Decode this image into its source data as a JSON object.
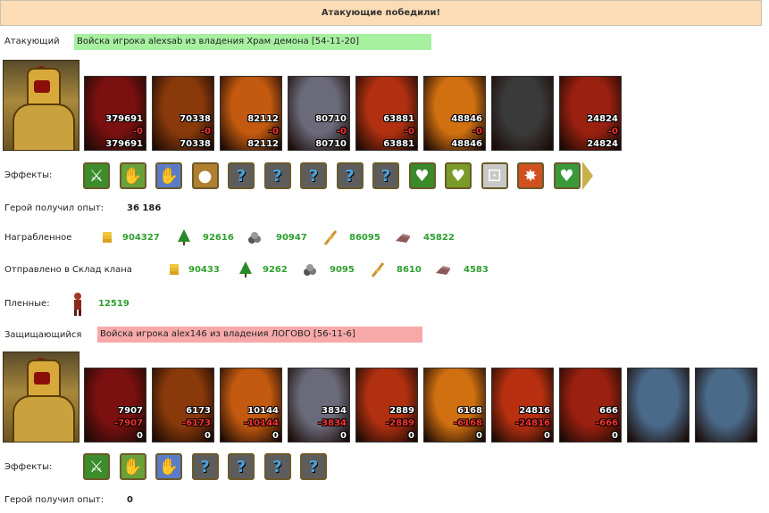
{
  "banner": "Атакующие победили!",
  "attacker": {
    "label": "Атакующий",
    "name": "Войска игрока alexsab из владения Храм демона [54-11-20]",
    "box_color": "#a6f0a0",
    "units": [
      {
        "icon": "red-dragon",
        "top": "379691",
        "mid": "-0",
        "bottom": "379691",
        "bg": "#7a1010"
      },
      {
        "icon": "skeleton-warrior",
        "top": "70338",
        "mid": "-0",
        "bottom": "70338",
        "bg": "#8a3a0a"
      },
      {
        "icon": "fire-beast",
        "top": "82112",
        "mid": "-0",
        "bottom": "82112",
        "bg": "#c35a10"
      },
      {
        "icon": "gargoyle",
        "top": "80710",
        "mid": "-0",
        "bottom": "80710",
        "bg": "#6a6a7a"
      },
      {
        "icon": "fire-elemental",
        "top": "63881",
        "mid": "-0",
        "bottom": "63881",
        "bg": "#b03010"
      },
      {
        "icon": "demon-warrior",
        "top": "48846",
        "mid": "-0",
        "bottom": "48846",
        "bg": "#d07010"
      },
      {
        "icon": "stone-golem",
        "top": "",
        "mid": "",
        "bottom": "",
        "bg": "#3a3a3a"
      },
      {
        "icon": "fire-mage",
        "top": "24824",
        "mid": "-0",
        "bottom": "24824",
        "bg": "#9a2010"
      }
    ],
    "effects_label": "Эффекты:",
    "effects": [
      {
        "icon": "sword-icon",
        "kind": "img",
        "bg": "#3c8c2c",
        "glyph": "⚔"
      },
      {
        "icon": "handshake-sword-icon",
        "kind": "img",
        "bg": "#6aa03a",
        "glyph": "✋"
      },
      {
        "icon": "hand-magic-icon",
        "kind": "img",
        "bg": "#5a7cc8",
        "glyph": "✋"
      },
      {
        "icon": "coins-icon",
        "kind": "img",
        "bg": "#b08030",
        "glyph": "●"
      },
      {
        "icon": "unknown-icon",
        "kind": "q",
        "glyph": "?"
      },
      {
        "icon": "unknown-icon",
        "kind": "q",
        "glyph": "?"
      },
      {
        "icon": "unknown-icon",
        "kind": "q",
        "glyph": "?"
      },
      {
        "icon": "unknown-icon",
        "kind": "q",
        "glyph": "?"
      },
      {
        "icon": "unknown-icon",
        "kind": "q",
        "glyph": "?"
      },
      {
        "icon": "apple-heart-icon",
        "kind": "img",
        "bg": "#3a8a2a",
        "glyph": "♥"
      },
      {
        "icon": "potion-heart-icon",
        "kind": "img",
        "bg": "#7a9a2a",
        "glyph": "♥"
      },
      {
        "icon": "dice-icon",
        "kind": "img",
        "bg": "#c8c8c8",
        "glyph": "⚀"
      },
      {
        "icon": "xp-burst-icon",
        "kind": "img",
        "bg": "#d05020",
        "glyph": "✸"
      },
      {
        "icon": "potion-green-icon",
        "kind": "img",
        "bg": "#3a9a3a",
        "glyph": "♥"
      }
    ],
    "xp_label": "Герой получил опыт:",
    "xp_value": "36 186"
  },
  "loot": {
    "label": "Награбленное",
    "items": [
      {
        "icon": "gold-icon",
        "value": "904327"
      },
      {
        "icon": "tree-icon",
        "value": "92616"
      },
      {
        "icon": "ore-icon",
        "value": "90947"
      },
      {
        "icon": "wheat-icon",
        "value": "86095"
      },
      {
        "icon": "stone-icon",
        "value": "45822"
      }
    ]
  },
  "clan": {
    "label": "Отправлено в Склад клана",
    "items": [
      {
        "icon": "gold-icon",
        "value": "90433"
      },
      {
        "icon": "tree-icon",
        "value": "9262"
      },
      {
        "icon": "ore-icon",
        "value": "9095"
      },
      {
        "icon": "wheat-icon",
        "value": "8610"
      },
      {
        "icon": "stone-icon",
        "value": "4583"
      }
    ]
  },
  "prisoners": {
    "label": "Пленные:",
    "value": "12519"
  },
  "defender": {
    "label": "Защищающийся",
    "name": "Войска игрока alex146 из владения ЛОГОВО [56-11-6]",
    "box_color": "#f7a9a9",
    "units": [
      {
        "icon": "red-dragon",
        "top": "7907",
        "mid": "-7907",
        "bottom": "0",
        "bg": "#7a1010"
      },
      {
        "icon": "skeleton-warrior",
        "top": "6173",
        "mid": "-6173",
        "bottom": "0",
        "bg": "#8a3a0a"
      },
      {
        "icon": "fire-beast",
        "top": "10144",
        "mid": "-10144",
        "bottom": "0",
        "bg": "#c35a10"
      },
      {
        "icon": "gargoyle",
        "top": "3834",
        "mid": "-3834",
        "bottom": "0",
        "bg": "#6a6a7a"
      },
      {
        "icon": "fire-elemental",
        "top": "2889",
        "mid": "-2889",
        "bottom": "0",
        "bg": "#b03010"
      },
      {
        "icon": "demon-warrior",
        "top": "6168",
        "mid": "-6168",
        "bottom": "0",
        "bg": "#d07010"
      },
      {
        "icon": "demon-lord",
        "top": "24816",
        "mid": "-24816",
        "bottom": "0",
        "bg": "#b83010"
      },
      {
        "icon": "fire-mage",
        "top": "666",
        "mid": "-666",
        "bottom": "0",
        "bg": "#9a2010"
      },
      {
        "icon": "dark-tower",
        "top": "",
        "mid": "",
        "bottom": "",
        "bg": "#4a6a8a"
      },
      {
        "icon": "dark-tower",
        "top": "",
        "mid": "",
        "bottom": "",
        "bg": "#4a6a8a"
      }
    ],
    "effects_label": "Эффекты:",
    "effects": [
      {
        "icon": "sword-icon",
        "kind": "img",
        "bg": "#3c8c2c",
        "glyph": "⚔"
      },
      {
        "icon": "handshake-sword-icon",
        "kind": "img",
        "bg": "#6aa03a",
        "glyph": "✋"
      },
      {
        "icon": "hand-magic-icon",
        "kind": "img",
        "bg": "#5a7cc8",
        "glyph": "✋"
      },
      {
        "icon": "unknown-icon",
        "kind": "q",
        "glyph": "?"
      },
      {
        "icon": "unknown-icon",
        "kind": "q",
        "glyph": "?"
      },
      {
        "icon": "unknown-icon",
        "kind": "q",
        "glyph": "?"
      },
      {
        "icon": "unknown-icon",
        "kind": "q",
        "glyph": "?"
      }
    ],
    "xp_label": "Герой получил опыт:",
    "xp_value": "0"
  }
}
